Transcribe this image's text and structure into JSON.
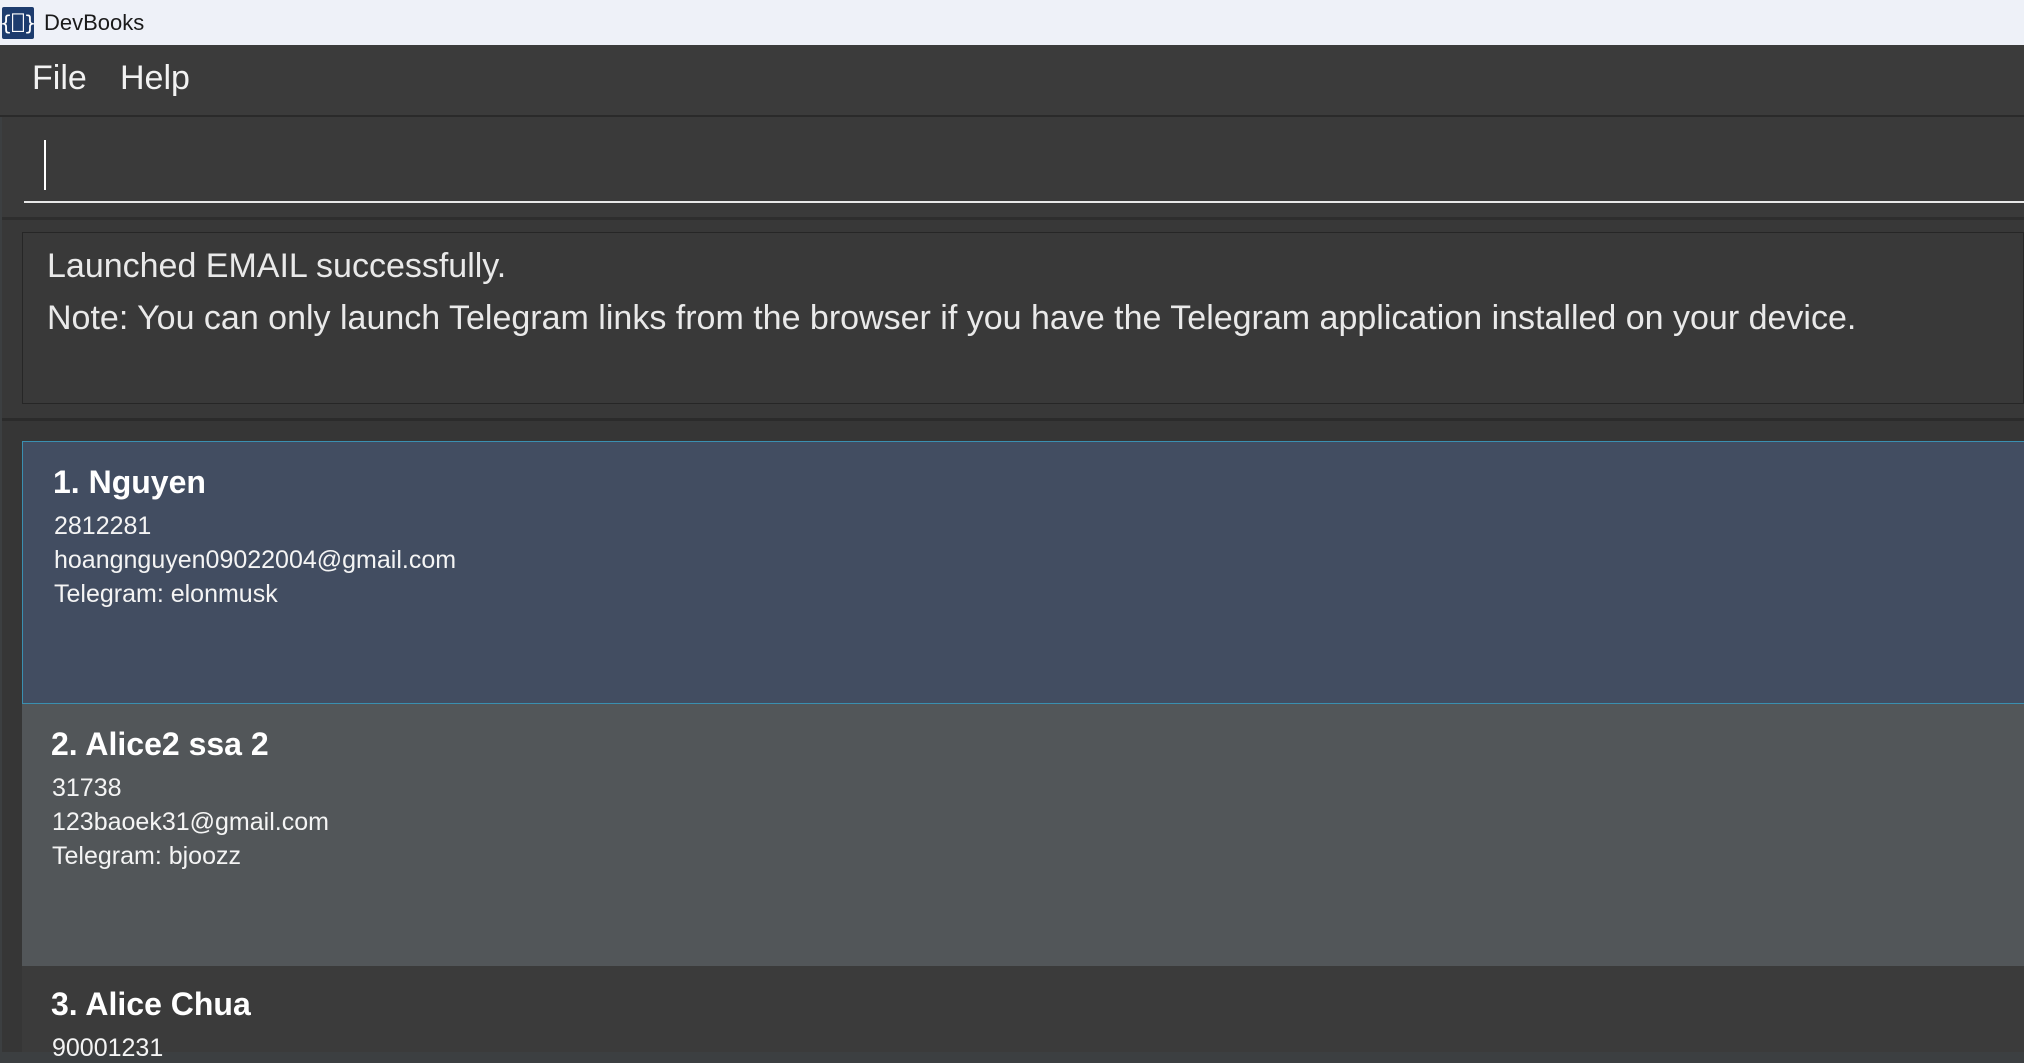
{
  "window": {
    "title": "DevBooks",
    "icon": "book-icon",
    "icon_glyph": "{⎕}"
  },
  "menu": {
    "file_label": "File",
    "help_label": "Help"
  },
  "command_box": {
    "value": "",
    "placeholder": ""
  },
  "result_display": {
    "line1": "Launched EMAIL successfully.",
    "line2": "Note: You can only launch Telegram links from the browser if you have the Telegram application installed on your device."
  },
  "persons": [
    {
      "index_name": "1. Nguyen",
      "phone": "2812281",
      "email": "hoangnguyen09022004@gmail.com",
      "telegram": "Telegram: elonmusk"
    },
    {
      "index_name": "2. Alice2 ssa 2",
      "phone": "31738",
      "email": "123baoek31@gmail.com",
      "telegram": "Telegram: bjoozz"
    },
    {
      "index_name": "3. Alice Chua",
      "phone": "90001231"
    }
  ],
  "colors": {
    "selected_card": "#424d61",
    "selected_border": "#3a8fb0",
    "alt_card": "#525659",
    "background": "#3c3f41"
  }
}
